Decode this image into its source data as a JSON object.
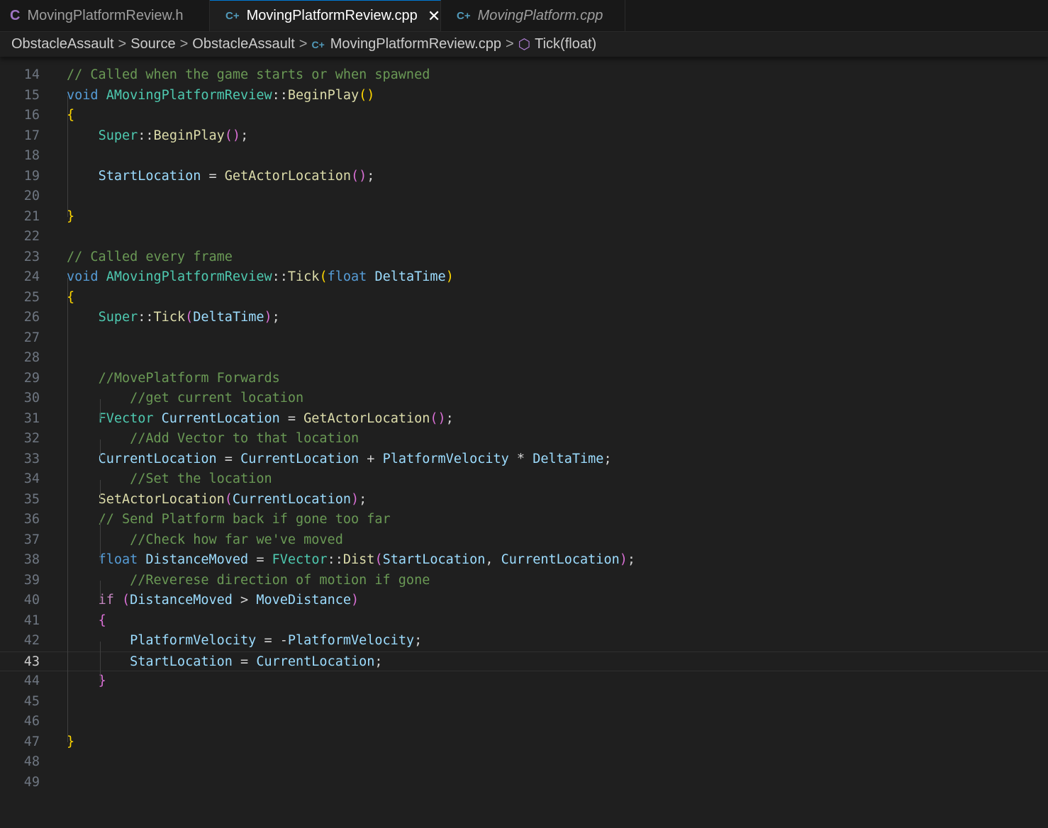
{
  "tabs": [
    {
      "icon": "C",
      "label": "MovingPlatformReview.h",
      "active": false,
      "italic": false
    },
    {
      "icon": "C+",
      "label": "MovingPlatformReview.cpp",
      "active": true,
      "italic": false,
      "close": "✕"
    },
    {
      "icon": "C+",
      "label": "MovingPlatform.cpp",
      "active": false,
      "italic": true
    }
  ],
  "breadcrumb": {
    "items": [
      "ObstacleAssault",
      "Source",
      "ObstacleAssault",
      "MovingPlatformReview.cpp",
      "Tick(float)"
    ],
    "separator": ">"
  },
  "editor": {
    "current_line": 43,
    "lines": [
      {
        "n": "14",
        "tokens": [
          [
            "cm",
            "// Called when the game starts or when spawned"
          ]
        ]
      },
      {
        "n": "15",
        "tokens": [
          [
            "kw",
            "void"
          ],
          [
            "pu",
            " "
          ],
          [
            "ty",
            "AMovingPlatformReview"
          ],
          [
            "pu",
            "::"
          ],
          [
            "fn",
            "BeginPlay"
          ],
          [
            "b1",
            "()"
          ]
        ]
      },
      {
        "n": "16",
        "tokens": [
          [
            "b1",
            "{"
          ]
        ]
      },
      {
        "n": "17",
        "tokens": [
          [
            "pu",
            "    "
          ],
          [
            "ty",
            "Super"
          ],
          [
            "pu",
            "::"
          ],
          [
            "fn",
            "BeginPlay"
          ],
          [
            "b2",
            "()"
          ],
          [
            "pu",
            ";"
          ]
        ]
      },
      {
        "n": "18",
        "tokens": []
      },
      {
        "n": "19",
        "tokens": [
          [
            "pu",
            "    "
          ],
          [
            "var",
            "StartLocation"
          ],
          [
            "pu",
            " = "
          ],
          [
            "fn",
            "GetActorLocation"
          ],
          [
            "b2",
            "()"
          ],
          [
            "pu",
            ";"
          ]
        ]
      },
      {
        "n": "20",
        "tokens": []
      },
      {
        "n": "21",
        "tokens": [
          [
            "b1",
            "}"
          ]
        ]
      },
      {
        "n": "22",
        "tokens": []
      },
      {
        "n": "23",
        "tokens": [
          [
            "cm",
            "// Called every frame"
          ]
        ]
      },
      {
        "n": "24",
        "tokens": [
          [
            "kw",
            "void"
          ],
          [
            "pu",
            " "
          ],
          [
            "ty",
            "AMovingPlatformReview"
          ],
          [
            "pu",
            "::"
          ],
          [
            "fn",
            "Tick"
          ],
          [
            "b1",
            "("
          ],
          [
            "kw",
            "float"
          ],
          [
            "pu",
            " "
          ],
          [
            "var",
            "DeltaTime"
          ],
          [
            "b1",
            ")"
          ]
        ]
      },
      {
        "n": "25",
        "tokens": [
          [
            "b1",
            "{"
          ]
        ]
      },
      {
        "n": "26",
        "tokens": [
          [
            "pu",
            "    "
          ],
          [
            "ty",
            "Super"
          ],
          [
            "pu",
            "::"
          ],
          [
            "fn",
            "Tick"
          ],
          [
            "b2",
            "("
          ],
          [
            "var",
            "DeltaTime"
          ],
          [
            "b2",
            ")"
          ],
          [
            "pu",
            ";"
          ]
        ]
      },
      {
        "n": "27",
        "tokens": []
      },
      {
        "n": "28",
        "tokens": []
      },
      {
        "n": "29",
        "tokens": [
          [
            "pu",
            "    "
          ],
          [
            "cm",
            "//MovePlatform Forwards"
          ]
        ]
      },
      {
        "n": "30",
        "tokens": [
          [
            "pu",
            "        "
          ],
          [
            "cm",
            "//get current location"
          ]
        ]
      },
      {
        "n": "31",
        "tokens": [
          [
            "pu",
            "    "
          ],
          [
            "ty",
            "FVector"
          ],
          [
            "pu",
            " "
          ],
          [
            "var",
            "CurrentLocation"
          ],
          [
            "pu",
            " = "
          ],
          [
            "fn",
            "GetActorLocation"
          ],
          [
            "b2",
            "()"
          ],
          [
            "pu",
            ";"
          ]
        ]
      },
      {
        "n": "32",
        "tokens": [
          [
            "pu",
            "        "
          ],
          [
            "cm",
            "//Add Vector to that location"
          ]
        ]
      },
      {
        "n": "33",
        "tokens": [
          [
            "pu",
            "    "
          ],
          [
            "var",
            "CurrentLocation"
          ],
          [
            "pu",
            " = "
          ],
          [
            "var",
            "CurrentLocation"
          ],
          [
            "pu",
            " + "
          ],
          [
            "var",
            "PlatformVelocity"
          ],
          [
            "pu",
            " * "
          ],
          [
            "var",
            "DeltaTime"
          ],
          [
            "pu",
            ";"
          ]
        ]
      },
      {
        "n": "34",
        "tokens": [
          [
            "pu",
            "        "
          ],
          [
            "cm",
            "//Set the location"
          ]
        ]
      },
      {
        "n": "35",
        "tokens": [
          [
            "pu",
            "    "
          ],
          [
            "fn",
            "SetActorLocation"
          ],
          [
            "b2",
            "("
          ],
          [
            "var",
            "CurrentLocation"
          ],
          [
            "b2",
            ")"
          ],
          [
            "pu",
            ";"
          ]
        ]
      },
      {
        "n": "36",
        "tokens": [
          [
            "pu",
            "    "
          ],
          [
            "cm",
            "// Send Platform back if gone too far"
          ]
        ]
      },
      {
        "n": "37",
        "tokens": [
          [
            "pu",
            "        "
          ],
          [
            "cm",
            "//Check how far we've moved"
          ]
        ]
      },
      {
        "n": "38",
        "tokens": [
          [
            "pu",
            "    "
          ],
          [
            "kw",
            "float"
          ],
          [
            "pu",
            " "
          ],
          [
            "var",
            "DistanceMoved"
          ],
          [
            "pu",
            " = "
          ],
          [
            "ty",
            "FVector"
          ],
          [
            "pu",
            "::"
          ],
          [
            "fn",
            "Dist"
          ],
          [
            "b2",
            "("
          ],
          [
            "var",
            "StartLocation"
          ],
          [
            "pu",
            ", "
          ],
          [
            "var",
            "CurrentLocation"
          ],
          [
            "b2",
            ")"
          ],
          [
            "pu",
            ";"
          ]
        ]
      },
      {
        "n": "39",
        "tokens": [
          [
            "pu",
            "        "
          ],
          [
            "cm",
            "//Reverese direction of motion if gone"
          ]
        ]
      },
      {
        "n": "40",
        "tokens": [
          [
            "pu",
            "    "
          ],
          [
            "kc",
            "if"
          ],
          [
            "pu",
            " "
          ],
          [
            "b2",
            "("
          ],
          [
            "var",
            "DistanceMoved"
          ],
          [
            "pu",
            " > "
          ],
          [
            "var",
            "MoveDistance"
          ],
          [
            "b2",
            ")"
          ]
        ]
      },
      {
        "n": "41",
        "tokens": [
          [
            "pu",
            "    "
          ],
          [
            "b2",
            "{"
          ]
        ]
      },
      {
        "n": "42",
        "tokens": [
          [
            "pu",
            "        "
          ],
          [
            "var",
            "PlatformVelocity"
          ],
          [
            "pu",
            " = -"
          ],
          [
            "var",
            "PlatformVelocity"
          ],
          [
            "pu",
            ";"
          ]
        ]
      },
      {
        "n": "43",
        "tokens": [
          [
            "pu",
            "        "
          ],
          [
            "var",
            "StartLocation"
          ],
          [
            "pu",
            " = "
          ],
          [
            "var",
            "CurrentLocation"
          ],
          [
            "pu",
            ";"
          ]
        ]
      },
      {
        "n": "44",
        "tokens": [
          [
            "pu",
            "    "
          ],
          [
            "b2",
            "}"
          ]
        ]
      },
      {
        "n": "45",
        "tokens": []
      },
      {
        "n": "46",
        "tokens": []
      },
      {
        "n": "47",
        "tokens": [
          [
            "b1",
            "}"
          ]
        ]
      },
      {
        "n": "48",
        "tokens": []
      },
      {
        "n": "49",
        "tokens": []
      }
    ]
  }
}
